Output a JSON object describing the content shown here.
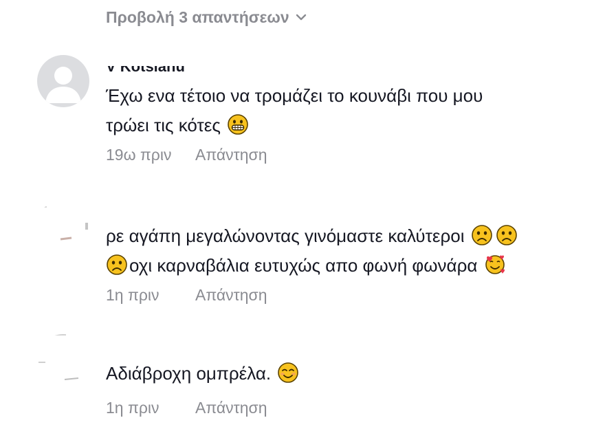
{
  "view_replies": {
    "label": "Προβολή 3 απαντήσεων",
    "icon": "chevron-down-icon"
  },
  "comments": [
    {
      "username": "V Kotsianu",
      "avatar": "default-avatar",
      "text_line1": "Έχω ενα τέτοιο να τρομάζει το κουνάβι που μου",
      "text_line2": "τρώει τις κότες",
      "emoji": "grinning-face-icon",
      "time": "19ω πριν",
      "reply": "Απάντηση"
    },
    {
      "username": "",
      "avatar": "blurred-avatar",
      "text_line1": "ρε αγάπη μεγαλώνοντας γινόμαστε καλύτεροι",
      "text_line2": "οχι καρναβάλια ευτυχώς απο φωνή φωνάρα",
      "emoji": "frowning-face-icon",
      "time": "1η πριν",
      "reply": "Απάντηση"
    },
    {
      "username": "",
      "avatar": "blurred-avatar",
      "text_line1": "Αδιάβροχη ομπρέλα.",
      "emoji": "smiling-face-icon",
      "time": "1η πριν",
      "reply": "Απάντηση"
    }
  ],
  "colors": {
    "primary_text": "#161823",
    "secondary_text": "#8a8b91",
    "avatar_bg": "#dcdde0",
    "emoji_yellow": "#f7c21e"
  }
}
